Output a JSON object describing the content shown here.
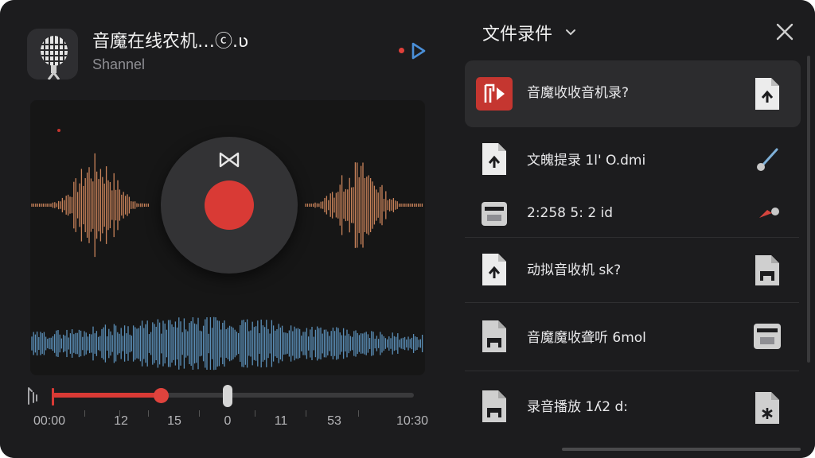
{
  "header": {
    "title": "音魔在线农机…ⓒ.ʋ",
    "subtitle": "Shannel",
    "app_icon": "microphone-icon",
    "live_indicator_color": "#e0403a",
    "play_icon": "play-outline-icon"
  },
  "recorder": {
    "record_color": "#d93a35",
    "mode_icon": "bowtie-icon",
    "warm_wave_color": "#c9835a",
    "cool_wave_color": "#5b8fb8"
  },
  "timeline": {
    "progress": 0.3,
    "marker_position": 0.48,
    "labels": [
      "00:00",
      "12",
      "15",
      "0",
      "11",
      "53",
      "10:30"
    ],
    "scrub_icon": "scrub-handle-icon"
  },
  "panel": {
    "title": "文件录件",
    "dropdown_icon": "chevron-down-icon",
    "close_icon": "close-icon",
    "items": [
      {
        "label": "音魔收收音机录?",
        "icon": "red-media-file-icon",
        "action": "upload-file-icon",
        "active": true
      },
      {
        "label": "文魄提录 1l' O.dmi",
        "icon": "upload-file-icon",
        "action": "pencil-icon",
        "active": false
      },
      {
        "label": "2:258 5:  2 id",
        "icon": "tape-icon",
        "action": "brush-icon",
        "active": false
      },
      {
        "label": "动拟音收机 sk?",
        "icon": "upload-file-icon",
        "action": "tape-file-icon",
        "active": false
      },
      {
        "label": "音魔魔收聋听 6mol",
        "icon": "tape-file-icon",
        "action": "tape-icon",
        "active": false
      },
      {
        "label": "录音播放 1ʎ2 d:",
        "icon": "tape-file-icon",
        "action": "star-file-icon",
        "active": false
      }
    ]
  }
}
